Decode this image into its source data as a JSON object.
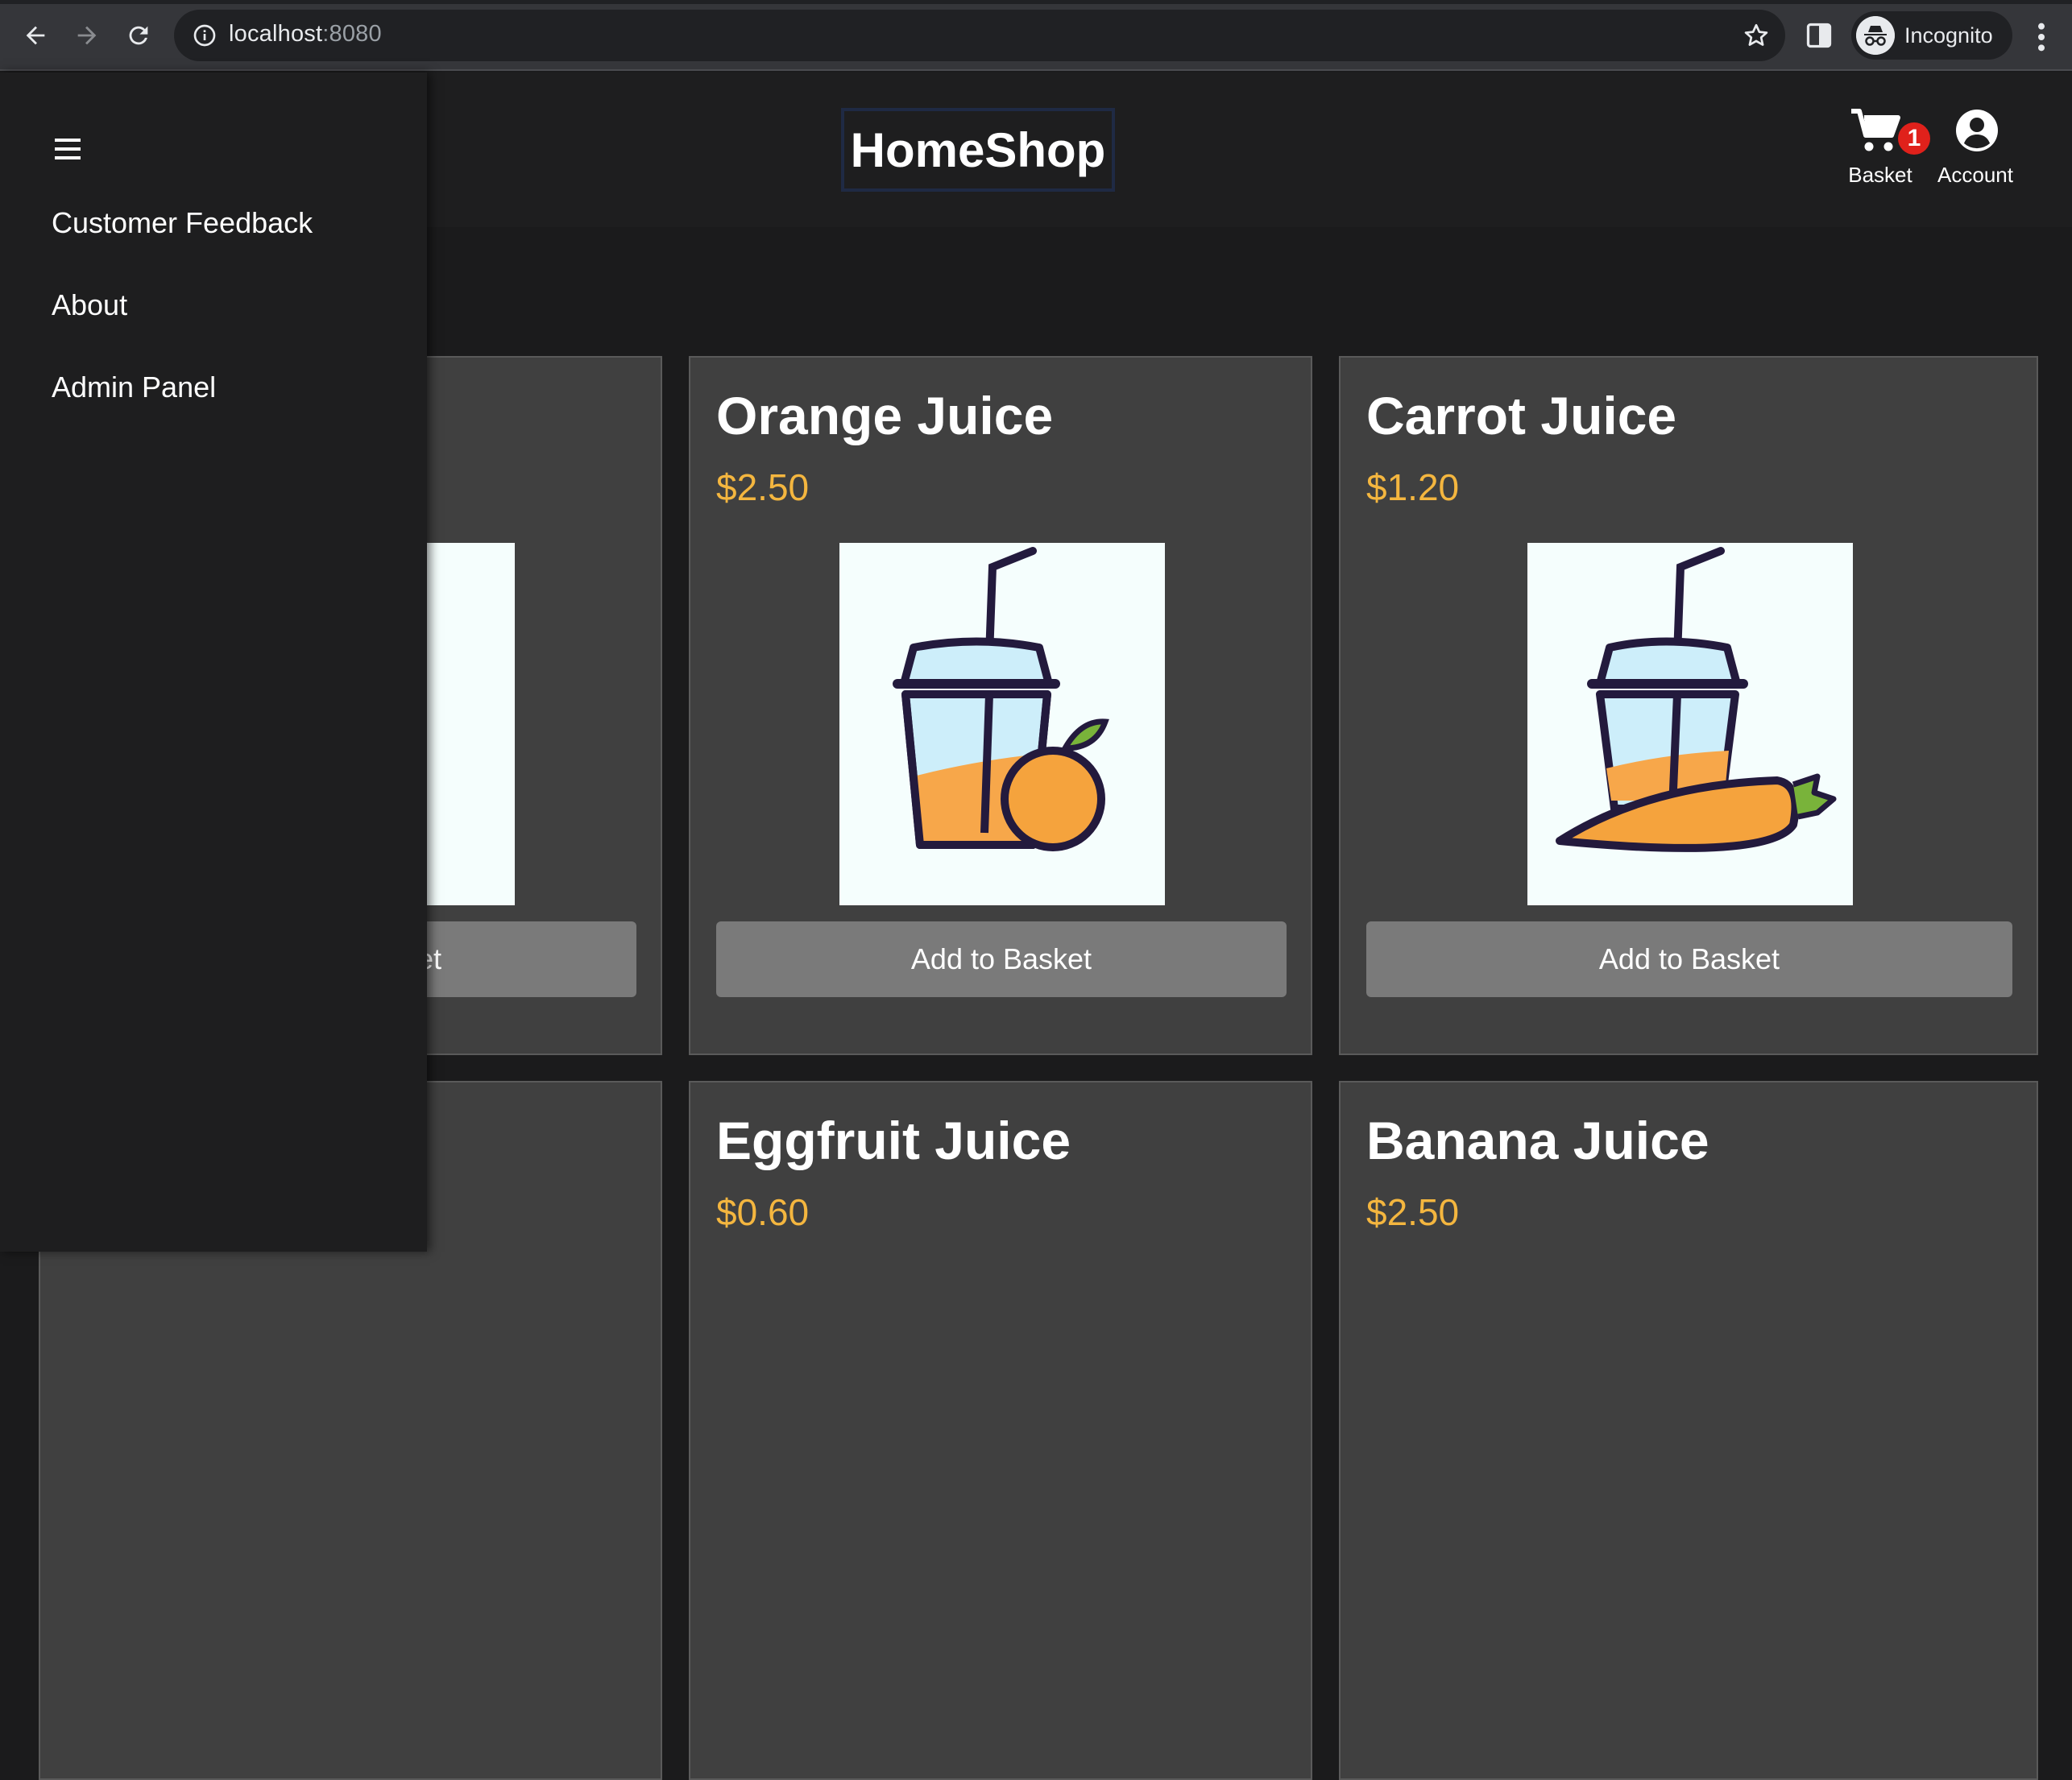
{
  "browser": {
    "url_host": "localhost",
    "url_port": ":8080",
    "profile_label": "Incognito",
    "icons": [
      "back-icon",
      "forward-icon",
      "reload-icon",
      "info-icon",
      "star-icon",
      "side-panel-icon",
      "incognito-icon",
      "more-vert-icon"
    ]
  },
  "header": {
    "logo": "HomeShop",
    "basket_label": "Basket",
    "basket_count": "1",
    "account_label": "Account"
  },
  "sidenav": {
    "items": [
      {
        "label": "Customer Feedback"
      },
      {
        "label": "About"
      },
      {
        "label": "Admin Panel"
      }
    ]
  },
  "products": [
    {
      "name": "",
      "price": "",
      "button": "Add to Basket"
    },
    {
      "name": "Orange Juice",
      "price": "$2.50",
      "button": "Add to Basket"
    },
    {
      "name": "Carrot Juice",
      "price": "$1.20",
      "button": "Add to Basket"
    },
    {
      "name": "",
      "price": ""
    },
    {
      "name": "Eggfruit Juice",
      "price": "$0.60"
    },
    {
      "name": "Banana Juice",
      "price": "$2.50"
    }
  ],
  "colors": {
    "price": "#f4b63f",
    "badge": "#e0211b",
    "card_bg": "#404040",
    "button_bg": "#7a7a7a"
  }
}
